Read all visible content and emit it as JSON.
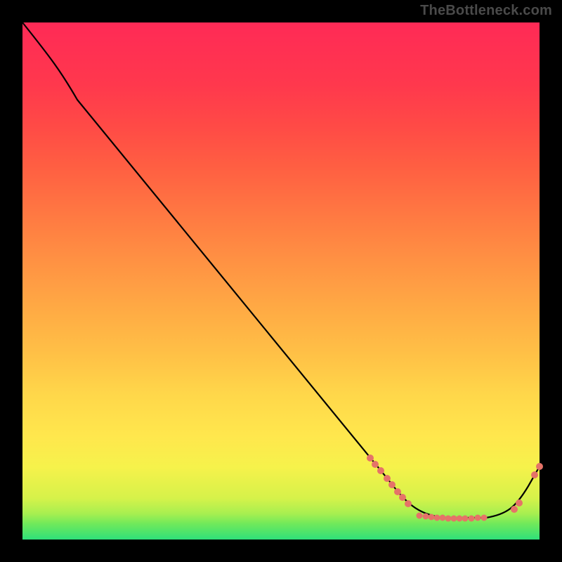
{
  "watermark": "TheBottleneck.com",
  "chart_data": {
    "type": "line",
    "title": "",
    "xlabel": "",
    "ylabel": "",
    "xlim": [
      0,
      100
    ],
    "ylim": [
      0,
      100
    ],
    "note": "Axes are unlabeled in the source image. x/y are normalised 0-100 from left/bottom. Curve descends from top-left, curves at start, reaches a flat minimum near x≈72-90 (y≈4), then rises toward the right edge (y≈14 at x=100). Background is a vertical green→yellow→red gradient on black.",
    "series": [
      {
        "name": "curve",
        "x": [
          0,
          7,
          11,
          70,
          76,
          82,
          90,
          95,
          98,
          100
        ],
        "y": [
          100,
          92,
          85,
          12,
          5,
          4,
          4,
          6,
          10,
          14
        ]
      },
      {
        "name": "dots",
        "x": [
          67,
          68,
          69,
          70.5,
          71.5,
          72.5,
          73.5,
          74.5,
          77,
          78,
          79,
          80,
          81,
          82,
          83,
          84.5,
          85.5,
          87,
          88,
          89,
          95,
          96,
          99,
          100
        ],
        "y": [
          16,
          14.5,
          13,
          12,
          10.5,
          9,
          8,
          7,
          4.5,
          4.5,
          4.2,
          4.2,
          4.2,
          4.1,
          4.1,
          4.1,
          4.1,
          4.1,
          4.2,
          4.2,
          6,
          7,
          12.5,
          14
        ]
      }
    ],
    "colors": {
      "curve": "#000000",
      "dots": "#e57368",
      "gradient_top": "#ff2a56",
      "gradient_mid": "#ffe74d",
      "gradient_bottom": "#2fe07a",
      "frame": "#000000",
      "watermark": "#4a4a4a"
    }
  }
}
